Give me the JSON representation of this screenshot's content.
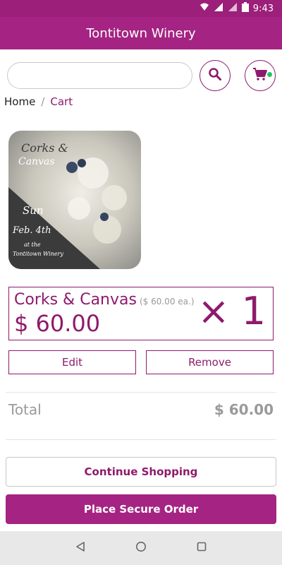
{
  "status_bar": {
    "time": "9:43"
  },
  "app_bar": {
    "title": "Tontitown Winery"
  },
  "search": {
    "value": "",
    "placeholder": ""
  },
  "breadcrumb": {
    "home": "Home",
    "separator": "/",
    "current": "Cart"
  },
  "product_image": {
    "line1": "Corks &",
    "line2": "Canvas",
    "line3": "Sun",
    "line4": "Feb. 4th",
    "line5": "at the",
    "line6": "Tontitown Winery"
  },
  "cart_item": {
    "name": "Corks & Canvas",
    "unit_price": "($ 60.00 ea.)",
    "price": "$ 60.00",
    "quantity": "× 1"
  },
  "buttons": {
    "edit": "Edit",
    "remove": "Remove",
    "continue": "Continue Shopping",
    "order": "Place Secure Order"
  },
  "totals": {
    "label": "Total",
    "value": "$ 60.00"
  },
  "colors": {
    "brand": "#a52382",
    "status_bar": "#9c1f7a",
    "accent_text": "#8e1a6c",
    "cart_dot": "#22c55e"
  },
  "icons": [
    "wifi-icon",
    "signal-icon",
    "battery-icon",
    "search-icon",
    "cart-icon",
    "back-icon",
    "home-icon",
    "recents-icon"
  ]
}
